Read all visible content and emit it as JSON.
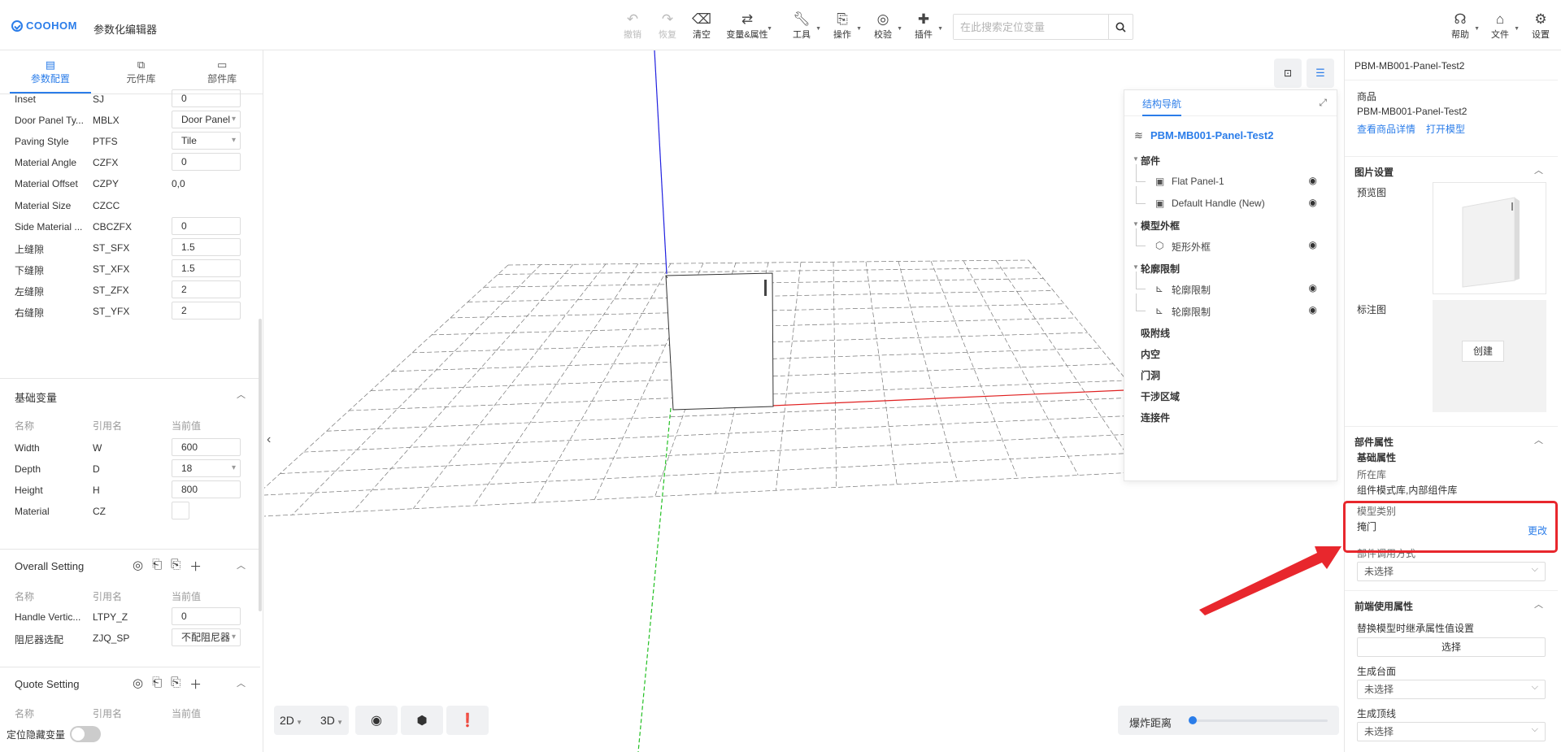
{
  "app": {
    "brand": "COOHOM",
    "title": "参数化编辑器"
  },
  "toolbar": {
    "undo": "撤销",
    "redo": "恢复",
    "clear": "清空",
    "variables": "变量&属性",
    "tools": "工具",
    "operate": "操作",
    "verify": "校验",
    "plugins": "插件",
    "search_placeholder": "在此搜索定位变量",
    "help": "帮助",
    "file": "文件",
    "settings": "设置"
  },
  "left_tabs": [
    "参数配置",
    "元件库",
    "部件库"
  ],
  "params_top": [
    {
      "name": "Inset",
      "ref": "SJ",
      "value": "0",
      "kind": "input"
    },
    {
      "name": "Door Panel Ty...",
      "ref": "MBLX",
      "value": "Door Panel",
      "kind": "select"
    },
    {
      "name": "Paving Style",
      "ref": "PTFS",
      "value": "Tile",
      "kind": "select"
    },
    {
      "name": "Material Angle",
      "ref": "CZFX",
      "value": "0",
      "kind": "input"
    },
    {
      "name": "Material Offset",
      "ref": "CZPY",
      "value": "0,0",
      "kind": "text"
    },
    {
      "name": "Material Size",
      "ref": "CZCC",
      "value": "",
      "kind": "text"
    },
    {
      "name": "Side Material ...",
      "ref": "CBCZFX",
      "value": "0",
      "kind": "input"
    },
    {
      "name": "上缝隙",
      "ref": "ST_SFX",
      "value": "1.5",
      "kind": "input"
    },
    {
      "name": "下缝隙",
      "ref": "ST_XFX",
      "value": "1.5",
      "kind": "input"
    },
    {
      "name": "左缝隙",
      "ref": "ST_ZFX",
      "value": "2",
      "kind": "input"
    },
    {
      "name": "右缝隙",
      "ref": "ST_YFX",
      "value": "2",
      "kind": "input"
    }
  ],
  "col_headers": {
    "name": "名称",
    "ref": "引用名",
    "value": "当前值"
  },
  "basic_vars": {
    "title": "基础变量",
    "rows": [
      {
        "name": "Width",
        "ref": "W",
        "value": "600",
        "kind": "input"
      },
      {
        "name": "Depth",
        "ref": "D",
        "value": "18",
        "kind": "select"
      },
      {
        "name": "Height",
        "ref": "H",
        "value": "800",
        "kind": "input"
      },
      {
        "name": "Material",
        "ref": "CZ",
        "value": "",
        "kind": "swatch"
      }
    ]
  },
  "overall": {
    "title": "Overall Setting",
    "rows": [
      {
        "name": "Handle Vertic...",
        "ref": "LTPY_Z",
        "value": "0",
        "kind": "input"
      },
      {
        "name": "阻尼器选配",
        "ref": "ZJQ_SP",
        "value": "不配阻尼器",
        "kind": "select"
      }
    ]
  },
  "quote": {
    "title": "Quote Setting"
  },
  "hidden_vars_label": "定位隐藏变量",
  "viewport": {
    "btn_2d": "2D",
    "btn_3d": "3D",
    "explode_label": "爆炸距离",
    "explode_value": 0
  },
  "nav": {
    "tab": "结构导航",
    "root": "PBM-MB001-Panel-Test2",
    "items": [
      {
        "label": "部件",
        "type": "group"
      },
      {
        "label": "Flat Panel-1",
        "type": "child"
      },
      {
        "label": "Default Handle (New)",
        "type": "child"
      },
      {
        "label": "模型外框",
        "type": "group"
      },
      {
        "label": "矩形外框",
        "type": "child"
      },
      {
        "label": "轮廓限制",
        "type": "group"
      },
      {
        "label": "轮廓限制",
        "type": "child"
      },
      {
        "label": "轮廓限制",
        "type": "child"
      },
      {
        "label": "吸附线",
        "type": "plain"
      },
      {
        "label": "内空",
        "type": "plain"
      },
      {
        "label": "门洞",
        "type": "plain"
      },
      {
        "label": "干涉区域",
        "type": "plain"
      },
      {
        "label": "连接件",
        "type": "plain"
      }
    ]
  },
  "right": {
    "title": "PBM-MB001-Panel-Test2",
    "product_label": "商品",
    "product_name": "PBM-MB001-Panel-Test2",
    "view_details": "查看商品详情",
    "open_model": "打开模型",
    "image_settings": "图片设置",
    "preview_label": "预览图",
    "annotation_label": "标注图",
    "create": "创建",
    "part_props": "部件属性",
    "basic_props": "基础属性",
    "library_label": "所在库",
    "library_value": "组件模式库,内部组件库",
    "model_type_label": "模型类别",
    "model_type_value": "掩门",
    "change": "更改",
    "call_mode_label": "部件调用方式",
    "unselected": "未选择",
    "frontend_props": "前端使用属性",
    "inherit_label": "替换模型时继承属性值设置",
    "select_btn": "选择",
    "gen_countertop": "生成台面",
    "gen_topline": "生成顶线"
  },
  "colors": {
    "accent": "#2b7de9",
    "highlight": "#e8272d",
    "axis_x": "#e02020",
    "axis_y": "#22c022",
    "axis_z": "#2020e0"
  }
}
